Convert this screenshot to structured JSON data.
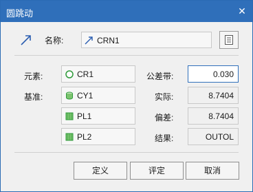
{
  "window": {
    "title": "圆跳动",
    "close_glyph": "✕"
  },
  "name": {
    "label": "名称:",
    "value": "CRN1"
  },
  "elements": {
    "label": "元素:",
    "item": "CR1"
  },
  "datum": {
    "label": "基准:",
    "items": [
      "CY1",
      "PL1",
      "PL2"
    ]
  },
  "tolerance": {
    "label": "公差带:",
    "value": "0.030"
  },
  "actual": {
    "label": "实际:",
    "value": "8.7404"
  },
  "deviation": {
    "label": "偏差:",
    "value": "8.7404"
  },
  "result": {
    "label": "结果:",
    "value": "OUTOL"
  },
  "buttons": {
    "define": "定义",
    "evaluate": "评定",
    "cancel": "取消"
  },
  "colors": {
    "titlebar": "#2f6fba",
    "icon_green": "#2e9a3a",
    "arrow_blue": "#2a5db0"
  }
}
